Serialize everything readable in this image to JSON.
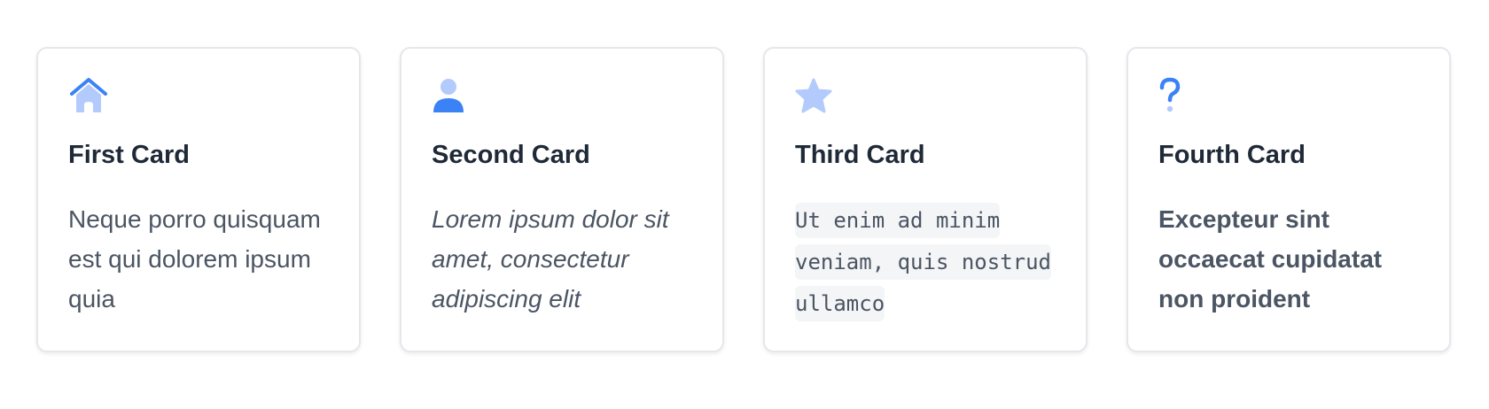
{
  "colors": {
    "accent": "#3b82f6",
    "accent_light": "#b3cbfc"
  },
  "cards": [
    {
      "icon": "home-icon",
      "title": "First Card",
      "text": "Neque porro quisquam est qui dolorem ipsum quia"
    },
    {
      "icon": "user-icon",
      "title": "Second Card",
      "text": "Lorem ipsum dolor sit amet, consectetur adipiscing elit"
    },
    {
      "icon": "star-icon",
      "title": "Third Card",
      "text": " Ut enim ad minim veniam, quis nostrud ullamco"
    },
    {
      "icon": "question-icon",
      "title": "Fourth Card",
      "text": "Excepteur sint occaecat cupidatat non proident"
    }
  ]
}
